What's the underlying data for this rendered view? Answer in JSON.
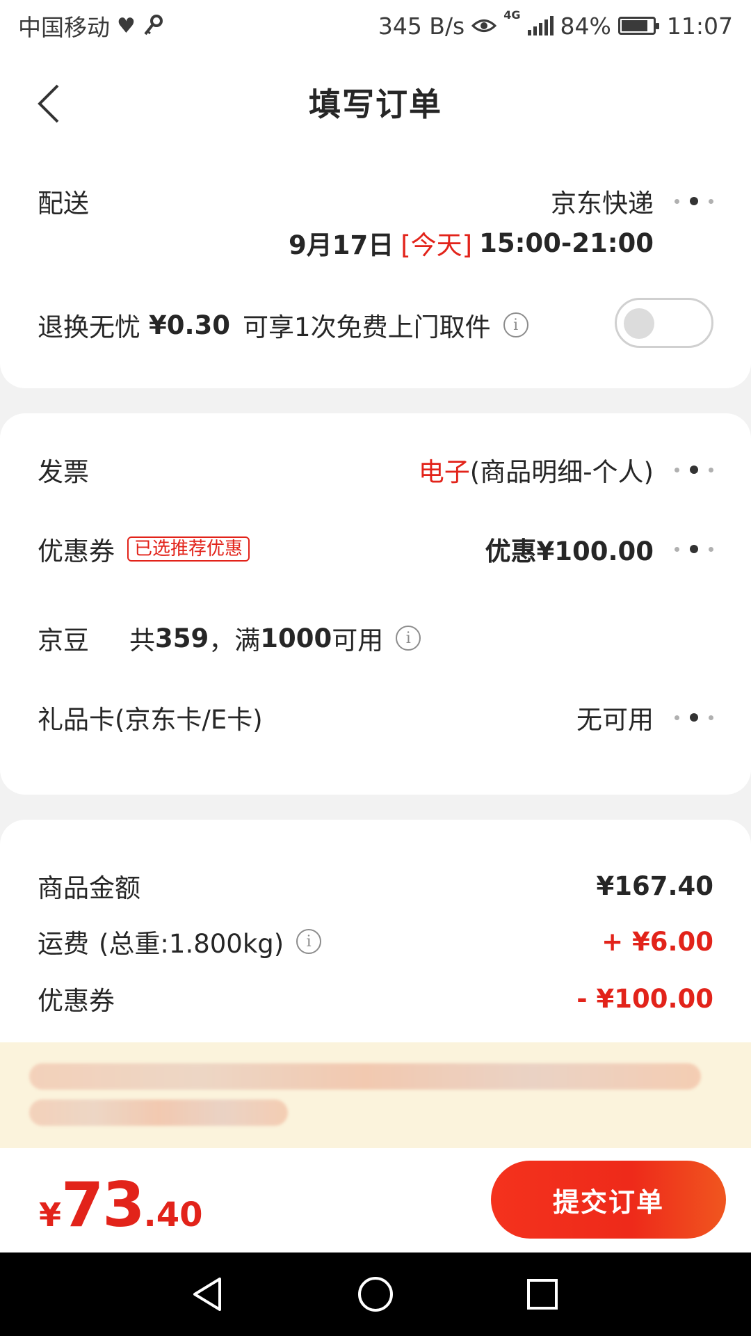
{
  "status_bar": {
    "carrier": "中国移动",
    "speed": "345 B/s",
    "network": "4G",
    "battery": "84%",
    "time": "11:07"
  },
  "header": {
    "title": "填写订单"
  },
  "delivery": {
    "label": "配送",
    "carrier_name": "京东快递",
    "date": "9月17日",
    "today_tag": "[今天]",
    "time_window": "15:00-21:00"
  },
  "return_insurance": {
    "label": "退换无忧",
    "price": "¥0.30",
    "desc": "可享1次免费上门取件",
    "enabled": false
  },
  "invoice": {
    "label": "发票",
    "type": "电子",
    "detail": "(商品明细-个人)"
  },
  "coupon": {
    "label": "优惠券",
    "tag": "已选推荐优惠",
    "value": "优惠¥100.00"
  },
  "jingdou": {
    "label": "京豆",
    "prefix": "共",
    "count": "359",
    "suffix": "，满",
    "threshold": "1000",
    "suffix2": "可用"
  },
  "gift_card": {
    "label": "礼品卡(京东卡/E卡)",
    "value": "无可用"
  },
  "summary": {
    "goods_label": "商品金额",
    "goods_value": "¥167.40",
    "shipping_label": "运费",
    "shipping_weight": "(总重:1.800kg)",
    "shipping_value": "+ ¥6.00",
    "coupon_label": "优惠券",
    "coupon_value": "- ¥100.00"
  },
  "footer": {
    "currency": "¥",
    "total_int": "73",
    "total_dec": ".40",
    "submit_label": "提交订单"
  },
  "colors": {
    "accent": "#e2231a",
    "notice_bg": "#fbf3dc"
  }
}
